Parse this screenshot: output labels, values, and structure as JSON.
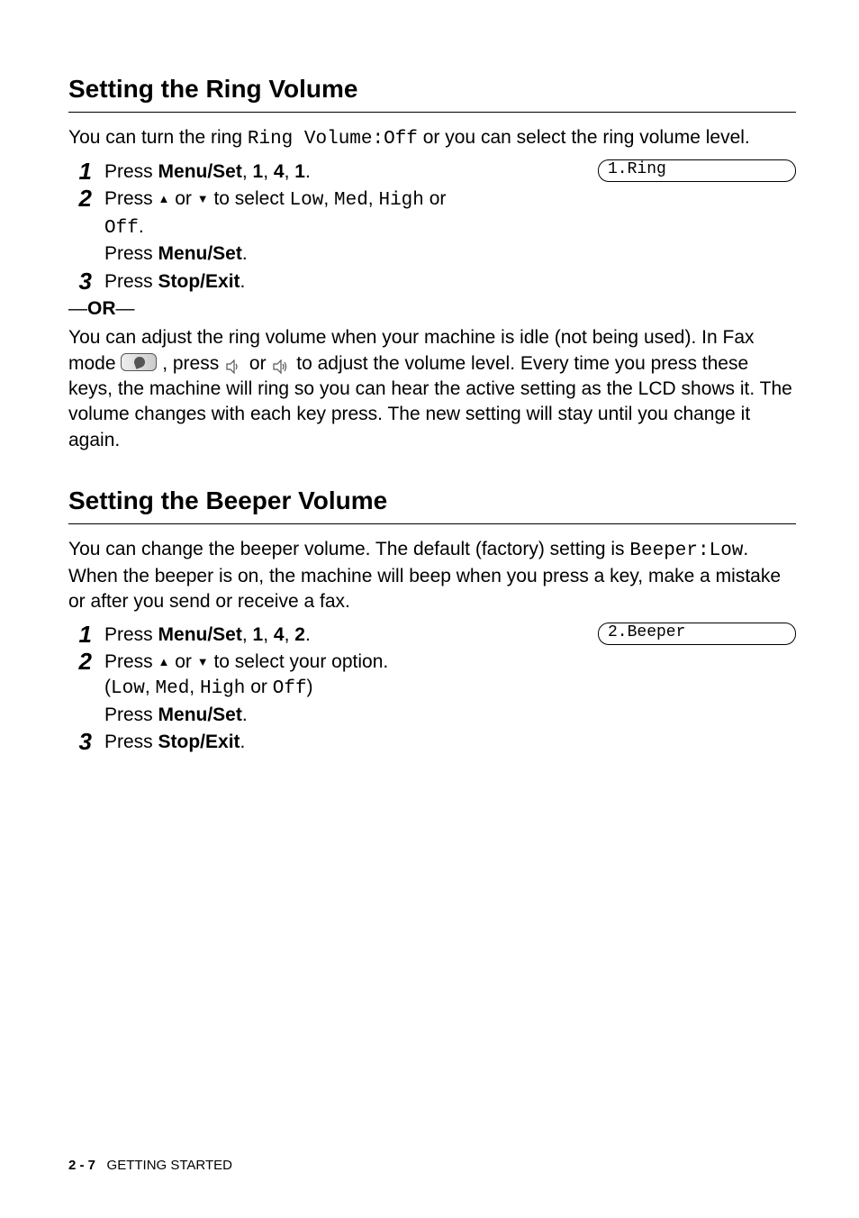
{
  "section1": {
    "title": "Setting the Ring Volume",
    "intro_a": "You can turn the ring ",
    "intro_mono": "Ring Volume:Off",
    "intro_b": " or you can select the ring volume level.",
    "step1_num": "1",
    "step1_a": "Press ",
    "step1_menu": "Menu/Set",
    "step1_sep1": ", ",
    "step1_k1": "1",
    "step1_sep2": ", ",
    "step1_k2": "4",
    "step1_sep3": ", ",
    "step1_k3": "1",
    "step1_end": ".",
    "lcd": "1.Ring",
    "step2_num": "2",
    "step2_a": "Press ",
    "step2_or": " or ",
    "step2_b": " to select ",
    "step2_low": "Low",
    "step2_c1": ", ",
    "step2_med": "Med",
    "step2_c2": ", ",
    "step2_high": "High",
    "step2_or2": " or ",
    "step2_off": "Off",
    "step2_end": ".",
    "step2_press": "Press ",
    "step2_menu": "Menu/Set",
    "step2_press_end": ".",
    "step3_num": "3",
    "step3_a": "Press ",
    "step3_stop": "Stop/Exit",
    "step3_end": ".",
    "or_label": "OR",
    "para_a": "You can adjust the ring volume when your machine is idle (not being used). In Fax mode ",
    "para_b": " , press  ",
    "para_c": "  or  ",
    "para_d": "  to adjust the volume level. Every time you press these keys, the machine will ring so you can hear the active setting as the LCD shows it. The volume changes with each key press. The new setting will stay until you change it again."
  },
  "section2": {
    "title": "Setting the Beeper Volume",
    "intro_a": "You can change the beeper volume. The default (factory) setting is ",
    "intro_mono": "Beeper:Low",
    "intro_b": ". When the beeper is on, the machine will beep when you press a key, make a mistake or after you send or receive a fax.",
    "step1_num": "1",
    "step1_a": "Press ",
    "step1_menu": "Menu/Set",
    "step1_sep1": ", ",
    "step1_k1": "1",
    "step1_sep2": ", ",
    "step1_k2": "4",
    "step1_sep3": ", ",
    "step1_k3": "2",
    "step1_end": ".",
    "lcd": "2.Beeper",
    "step2_num": "2",
    "step2_a": "Press ",
    "step2_or": " or ",
    "step2_b": " to select your option.",
    "step2_paren_open": "(",
    "step2_low": "Low",
    "step2_c1": ", ",
    "step2_med": "Med",
    "step2_c2": ", ",
    "step2_high": "High",
    "step2_or2": " or ",
    "step2_off": "Off",
    "step2_paren_close": ")",
    "step2_press": "Press ",
    "step2_menu": "Menu/Set",
    "step2_press_end": ".",
    "step3_num": "3",
    "step3_a": "Press ",
    "step3_stop": "Stop/Exit",
    "step3_end": "."
  },
  "footer": {
    "page": "2 - 7",
    "chapter": "GETTING STARTED"
  }
}
